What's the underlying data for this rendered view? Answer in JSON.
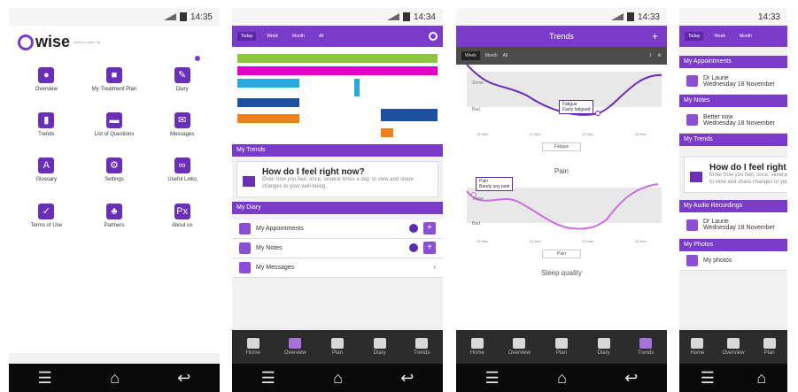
{
  "status": {
    "time_1": "14:35",
    "time_2": "14:34",
    "time_3": "14:33",
    "time_4": "14:33"
  },
  "colors": {
    "brand": "#7a3cc8",
    "dark_bar": "#2c2c2c"
  },
  "screen1": {
    "brand": "wise",
    "brand_sub": "www.a-i-wise.org",
    "menu": [
      {
        "label": "Overview",
        "icon": "overview-icon",
        "glyph": "●"
      },
      {
        "label": "My Treatment Plan",
        "icon": "briefcase-icon",
        "glyph": "■"
      },
      {
        "label": "Diary",
        "icon": "diary-icon",
        "glyph": "✎"
      },
      {
        "label": "Trends",
        "icon": "bar-chart-icon",
        "glyph": "▮"
      },
      {
        "label": "List of Questions",
        "icon": "questions-icon",
        "glyph": "▬"
      },
      {
        "label": "Messages",
        "icon": "envelope-icon",
        "glyph": "✉"
      },
      {
        "label": "Glossary",
        "icon": "glossary-icon",
        "glyph": "A"
      },
      {
        "label": "Settings",
        "icon": "settings-icon",
        "glyph": "⚙"
      },
      {
        "label": "Useful Links",
        "icon": "link-icon",
        "glyph": "∞"
      },
      {
        "label": "Terms of Use",
        "icon": "checkbox-icon",
        "glyph": "✓"
      },
      {
        "label": "Partners",
        "icon": "paw-icon",
        "glyph": "♣"
      },
      {
        "label": "About us",
        "icon": "px-icon",
        "glyph": "Px"
      }
    ]
  },
  "screen2": {
    "tabs": [
      "Today",
      "Week",
      "Month",
      "All"
    ],
    "bars": [
      "",
      "",
      "",
      "",
      ""
    ],
    "trends_header": "My Trends",
    "card_title": "How do I feel right now?",
    "card_desc": "Enter how you feel, once, several times a day, to view and share changes to your well-being.",
    "diary_header": "My Diary",
    "rows": [
      {
        "label": "My Appointments",
        "badge": "1"
      },
      {
        "label": "My Notes",
        "badge": "1"
      },
      {
        "label": "My Messages",
        "badge": ""
      }
    ],
    "tabbar": [
      "Home",
      "Overview",
      "Plan",
      "Diary",
      "Trends"
    ]
  },
  "screen3": {
    "title": "Trends",
    "ranges": [
      "Week",
      "Month",
      "All"
    ],
    "chart1_callout_title": "Fatigue",
    "chart1_callout_sub": "Fairly fatigued",
    "chart1_legend": "Fatigue",
    "chart2_title": "Pain",
    "chart2_callout_title": "Pain",
    "chart2_callout_sub": "Barely any pain",
    "chart2_legend": "Pain",
    "chart3_title": "Sleep quality",
    "x_ticks": [
      "20 Nov",
      "21 Nov",
      "22 Nov",
      "23 Nov"
    ],
    "y_label_top": "Some",
    "y_label_bot": "Bad",
    "tabbar": [
      "Home",
      "Overview",
      "Plan",
      "Diary",
      "Trends"
    ]
  },
  "screen4": {
    "tabs": [
      "Today",
      "Week",
      "Month"
    ],
    "sec1": "My Appointments",
    "appt1_name": "Dr Laurie",
    "appt1_date": "Wednesday 18 November",
    "sec2": "My Notes",
    "note_name": "Better now",
    "note_date": "Wednesday 18 November",
    "sec3": "My Trends",
    "card_title": "How do I feel right now?",
    "card_desc": "Enter how you feel, once, several times a day, to view and share changes to your well-being.",
    "sec4": "My Audio Recordings",
    "appt2_name": "Dr Laurie",
    "appt2_date": "Wednesday 18 November",
    "sec5": "My Photos",
    "photo_row": "My photos",
    "tabbar": [
      "Home",
      "Overview",
      "Plan"
    ]
  }
}
